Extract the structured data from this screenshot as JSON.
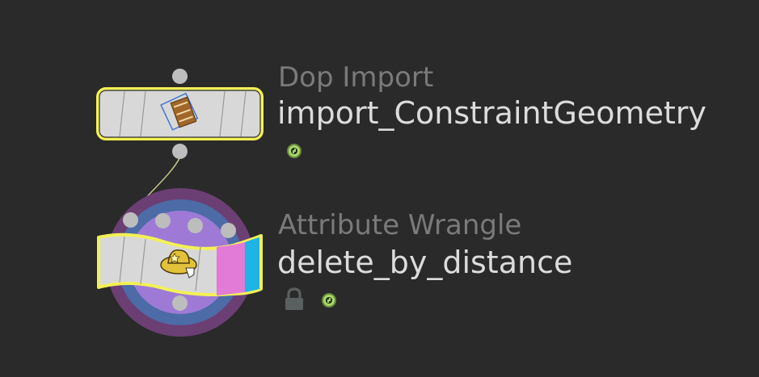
{
  "nodes": [
    {
      "type": "Dop Import",
      "name": "import_ConstraintGeometry",
      "flags": [
        "clock-icon"
      ],
      "selected": true,
      "highlight_color": "#f3f056"
    },
    {
      "type": "Attribute Wrangle",
      "name": "delete_by_distance",
      "flags": [
        "lock-icon",
        "clock-icon"
      ],
      "selected": true,
      "highlight_color": "#f3f056",
      "color_strip": [
        "#e27ad8",
        "#1fb3e6"
      ]
    }
  ],
  "colors": {
    "background": "#2a2a2a",
    "node_body": "#d9d9d9",
    "port": "#bdbdbd",
    "type_text": "#7a7a7a",
    "name_text": "#dcdcdc",
    "ring_outer": "#6b3f74",
    "ring_mid": "#4d6ba6",
    "ring_inner": "#9e7ad6"
  }
}
